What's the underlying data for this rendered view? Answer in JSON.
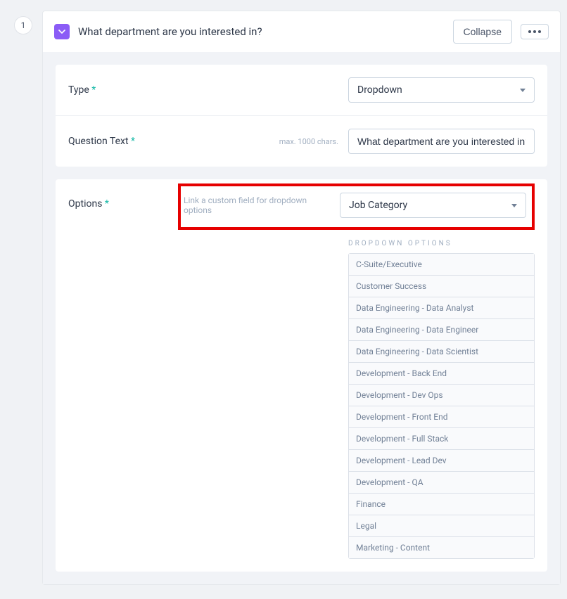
{
  "step_number": "1",
  "header": {
    "question_title": "What department are you interested in?",
    "collapse_label": "Collapse"
  },
  "fields": {
    "type_label": "Type",
    "type_value": "Dropdown",
    "question_text_label": "Question Text",
    "max_chars": "max. 1000 chars.",
    "question_text_value": "What department are you interested in?",
    "options_label": "Options",
    "link_hint": "Link a custom field for dropdown options",
    "custom_field_value": "Job Category",
    "dropdown_options_header": "DROPDOWN OPTIONS",
    "required_star": "*"
  },
  "dropdown_options": [
    "C-Suite/Executive",
    "Customer Success",
    "Data Engineering - Data Analyst",
    "Data Engineering - Data Engineer",
    "Data Engineering - Data Scientist",
    "Development - Back End",
    "Development - Dev Ops",
    "Development - Front End",
    "Development - Full Stack",
    "Development - Lead Dev",
    "Development - QA",
    "Finance",
    "Legal",
    "Marketing - Content"
  ]
}
